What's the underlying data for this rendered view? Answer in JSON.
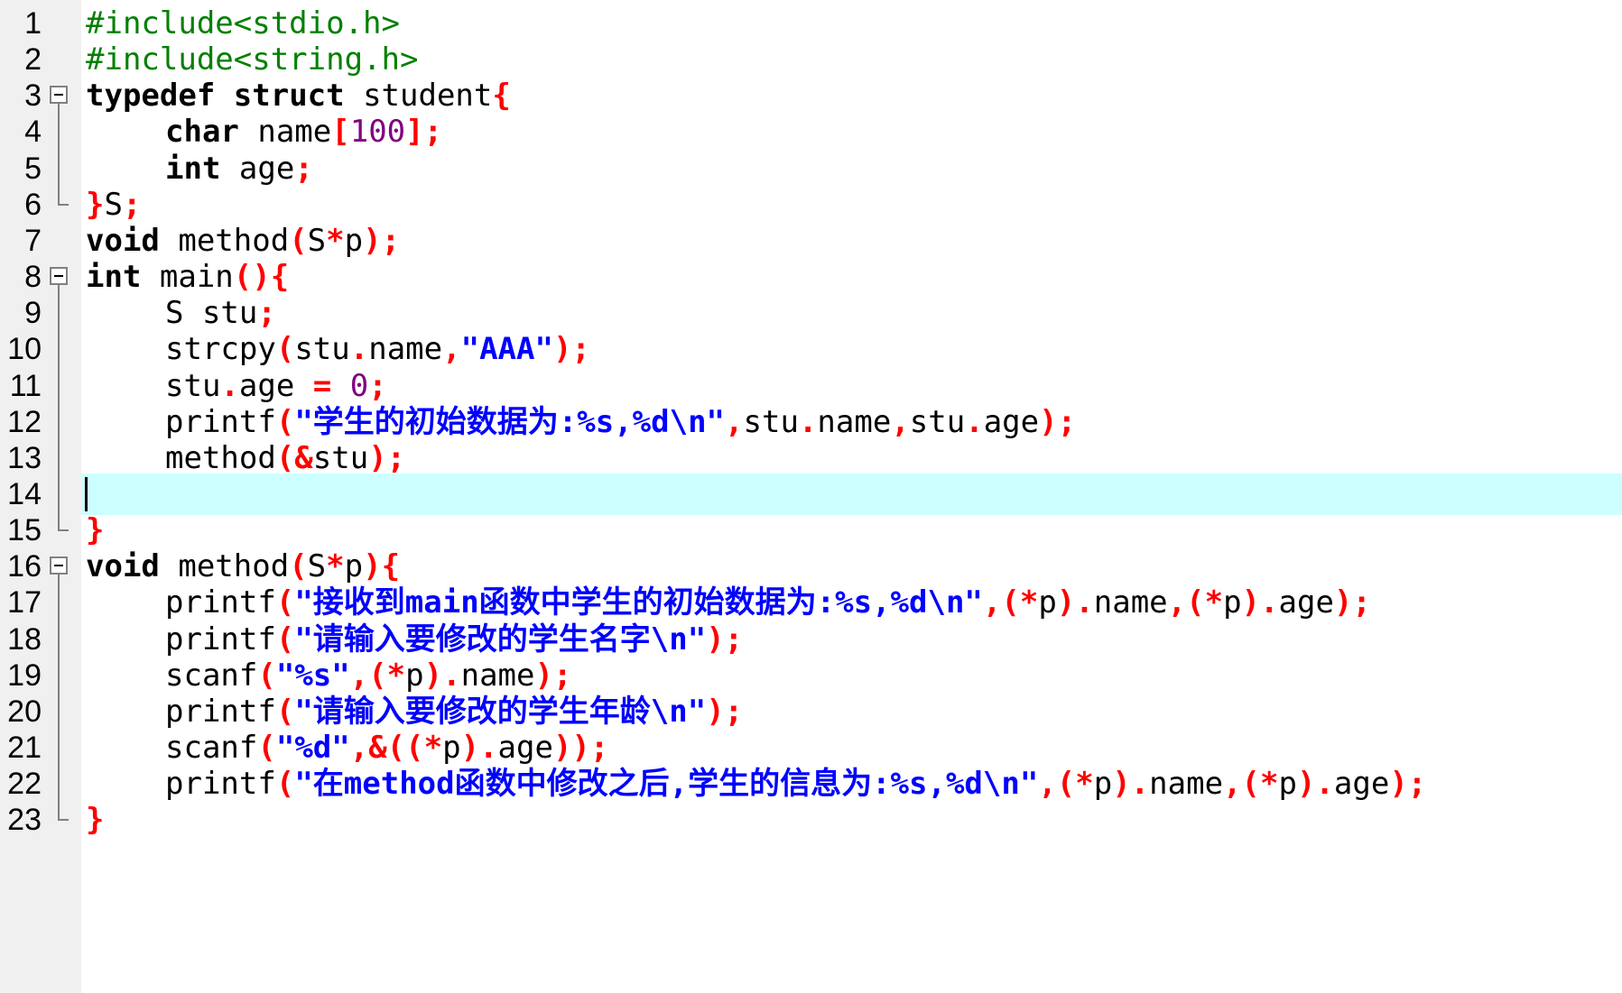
{
  "editor": {
    "colors": {
      "gutter_bg": "#f0f0f0",
      "current_line_bg": "#ccffff",
      "preprocessor": "#008000",
      "keyword": "#000000",
      "operator": "#ff0000",
      "number": "#800080",
      "string": "#0000ff"
    },
    "current_line": 14,
    "lines": [
      {
        "n": "1",
        "indent": false,
        "fold": null,
        "tokens": [
          [
            "pp",
            "#include<stdio.h>"
          ]
        ]
      },
      {
        "n": "2",
        "indent": false,
        "fold": null,
        "tokens": [
          [
            "pp",
            "#include<string.h>"
          ]
        ]
      },
      {
        "n": "3",
        "indent": false,
        "fold": "start",
        "tokens": [
          [
            "kw",
            "typedef"
          ],
          [
            "id",
            " "
          ],
          [
            "kw",
            "struct"
          ],
          [
            "id",
            " student"
          ],
          [
            "op",
            "{"
          ]
        ]
      },
      {
        "n": "4",
        "indent": true,
        "fold": "body",
        "tokens": [
          [
            "kw",
            "char"
          ],
          [
            "id",
            " name"
          ],
          [
            "op",
            "["
          ],
          [
            "num",
            "100"
          ],
          [
            "op",
            "];"
          ]
        ]
      },
      {
        "n": "5",
        "indent": true,
        "fold": "body",
        "tokens": [
          [
            "kw",
            "int"
          ],
          [
            "id",
            " age"
          ],
          [
            "op",
            ";"
          ]
        ]
      },
      {
        "n": "6",
        "indent": false,
        "fold": "end",
        "tokens": [
          [
            "op",
            "}"
          ],
          [
            "id",
            "S"
          ],
          [
            "op",
            ";"
          ]
        ]
      },
      {
        "n": "7",
        "indent": false,
        "fold": null,
        "tokens": [
          [
            "kw",
            "void"
          ],
          [
            "id",
            " method"
          ],
          [
            "op",
            "("
          ],
          [
            "id",
            "S"
          ],
          [
            "op",
            "*"
          ],
          [
            "id",
            "p"
          ],
          [
            "op",
            ");"
          ]
        ]
      },
      {
        "n": "8",
        "indent": false,
        "fold": "start",
        "tokens": [
          [
            "kw",
            "int"
          ],
          [
            "id",
            " main"
          ],
          [
            "op",
            "(){"
          ]
        ]
      },
      {
        "n": "9",
        "indent": true,
        "fold": "body",
        "tokens": [
          [
            "id",
            "S stu"
          ],
          [
            "op",
            ";"
          ]
        ]
      },
      {
        "n": "10",
        "indent": true,
        "fold": "body",
        "tokens": [
          [
            "id",
            "strcpy"
          ],
          [
            "op",
            "("
          ],
          [
            "id",
            "stu"
          ],
          [
            "op",
            "."
          ],
          [
            "id",
            "name"
          ],
          [
            "op",
            ","
          ],
          [
            "str",
            "\"AAA\""
          ],
          [
            "op",
            ");"
          ]
        ]
      },
      {
        "n": "11",
        "indent": true,
        "fold": "body",
        "tokens": [
          [
            "id",
            "stu"
          ],
          [
            "op",
            "."
          ],
          [
            "id",
            "age "
          ],
          [
            "op",
            "="
          ],
          [
            "id",
            " "
          ],
          [
            "num",
            "0"
          ],
          [
            "op",
            ";"
          ]
        ]
      },
      {
        "n": "12",
        "indent": true,
        "fold": "body",
        "tokens": [
          [
            "id",
            "printf"
          ],
          [
            "op",
            "("
          ],
          [
            "str",
            "\"学生的初始数据为:%s,%d\\n\""
          ],
          [
            "op",
            ","
          ],
          [
            "id",
            "stu"
          ],
          [
            "op",
            "."
          ],
          [
            "id",
            "name"
          ],
          [
            "op",
            ","
          ],
          [
            "id",
            "stu"
          ],
          [
            "op",
            "."
          ],
          [
            "id",
            "age"
          ],
          [
            "op",
            ");"
          ]
        ]
      },
      {
        "n": "13",
        "indent": true,
        "fold": "body",
        "tokens": [
          [
            "id",
            "method"
          ],
          [
            "op",
            "(&"
          ],
          [
            "id",
            "stu"
          ],
          [
            "op",
            ");"
          ]
        ]
      },
      {
        "n": "14",
        "indent": false,
        "fold": "body",
        "tokens": []
      },
      {
        "n": "15",
        "indent": false,
        "fold": "end",
        "tokens": [
          [
            "op",
            "}"
          ]
        ]
      },
      {
        "n": "16",
        "indent": false,
        "fold": "start",
        "tokens": [
          [
            "kw",
            "void"
          ],
          [
            "id",
            " method"
          ],
          [
            "op",
            "("
          ],
          [
            "id",
            "S"
          ],
          [
            "op",
            "*"
          ],
          [
            "id",
            "p"
          ],
          [
            "op",
            "){"
          ]
        ]
      },
      {
        "n": "17",
        "indent": true,
        "fold": "body",
        "tokens": [
          [
            "id",
            "printf"
          ],
          [
            "op",
            "("
          ],
          [
            "str",
            "\"接收到main函数中学生的初始数据为:%s,%d\\n\""
          ],
          [
            "op",
            ",(*"
          ],
          [
            "id",
            "p"
          ],
          [
            "op",
            ")."
          ],
          [
            "id",
            "name"
          ],
          [
            "op",
            ",(*"
          ],
          [
            "id",
            "p"
          ],
          [
            "op",
            ")."
          ],
          [
            "id",
            "age"
          ],
          [
            "op",
            ");"
          ]
        ]
      },
      {
        "n": "18",
        "indent": true,
        "fold": "body",
        "tokens": [
          [
            "id",
            "printf"
          ],
          [
            "op",
            "("
          ],
          [
            "str",
            "\"请输入要修改的学生名字\\n\""
          ],
          [
            "op",
            ");"
          ]
        ]
      },
      {
        "n": "19",
        "indent": true,
        "fold": "body",
        "tokens": [
          [
            "id",
            "scanf"
          ],
          [
            "op",
            "("
          ],
          [
            "str",
            "\"%s\""
          ],
          [
            "op",
            ",(*"
          ],
          [
            "id",
            "p"
          ],
          [
            "op",
            ")."
          ],
          [
            "id",
            "name"
          ],
          [
            "op",
            ");"
          ]
        ]
      },
      {
        "n": "20",
        "indent": true,
        "fold": "body",
        "tokens": [
          [
            "id",
            "printf"
          ],
          [
            "op",
            "("
          ],
          [
            "str",
            "\"请输入要修改的学生年龄\\n\""
          ],
          [
            "op",
            ");"
          ]
        ]
      },
      {
        "n": "21",
        "indent": true,
        "fold": "body",
        "tokens": [
          [
            "id",
            "scanf"
          ],
          [
            "op",
            "("
          ],
          [
            "str",
            "\"%d\""
          ],
          [
            "op",
            ",&((*"
          ],
          [
            "id",
            "p"
          ],
          [
            "op",
            ")."
          ],
          [
            "id",
            "age"
          ],
          [
            "op",
            "));"
          ]
        ]
      },
      {
        "n": "22",
        "indent": true,
        "fold": "body",
        "tokens": [
          [
            "id",
            "printf"
          ],
          [
            "op",
            "("
          ],
          [
            "str",
            "\"在method函数中修改之后,学生的信息为:%s,%d\\n\""
          ],
          [
            "op",
            ",(*"
          ],
          [
            "id",
            "p"
          ],
          [
            "op",
            ")."
          ],
          [
            "id",
            "name"
          ],
          [
            "op",
            ",(*"
          ],
          [
            "id",
            "p"
          ],
          [
            "op",
            ")."
          ],
          [
            "id",
            "age"
          ],
          [
            "op",
            ");"
          ]
        ]
      },
      {
        "n": "23",
        "indent": false,
        "fold": "end",
        "tokens": [
          [
            "op",
            "}"
          ]
        ]
      }
    ]
  }
}
